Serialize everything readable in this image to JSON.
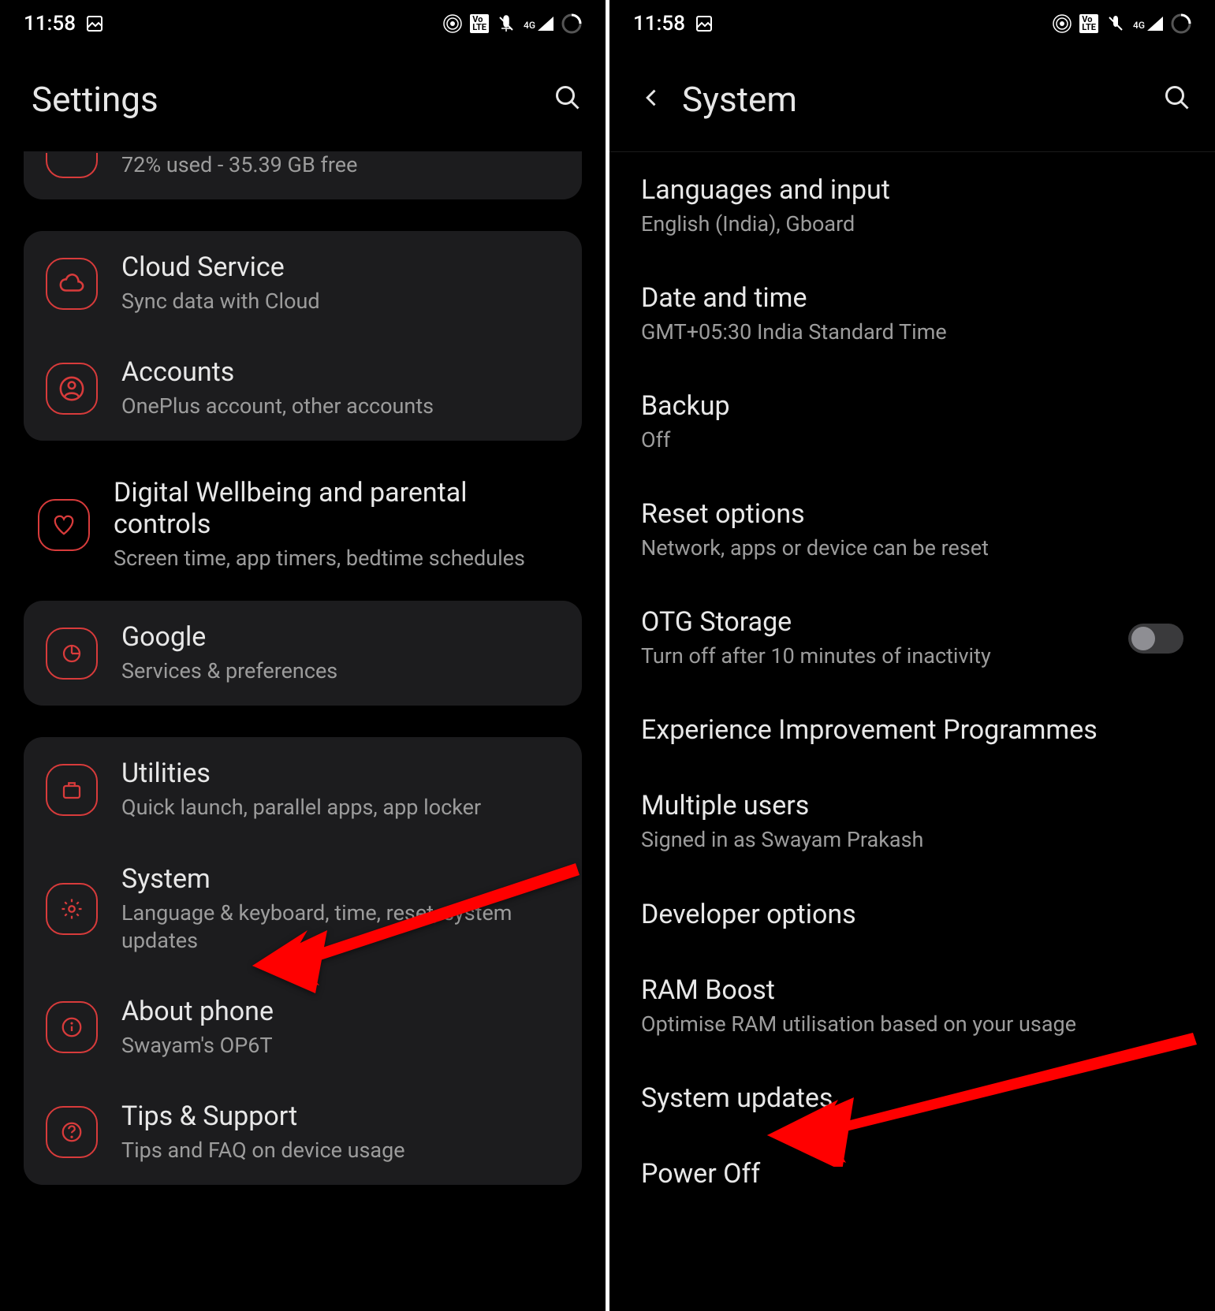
{
  "status": {
    "time": "11:58",
    "lte_badge": "Vo LTE",
    "signal_badge": "4G"
  },
  "left": {
    "header_title": "Settings",
    "storage_sub": "72% used - 35.39 GB free",
    "groups": [
      {
        "items": [
          {
            "title": "Cloud Service",
            "sub": "Sync data with Cloud"
          },
          {
            "title": "Accounts",
            "sub": "OnePlus account, other accounts"
          }
        ]
      }
    ],
    "wellbeing": {
      "title": "Digital Wellbeing and parental controls",
      "sub": "Screen time, app timers, bedtime schedules"
    },
    "google": {
      "title": "Google",
      "sub": "Services & preferences"
    },
    "utilities": {
      "title": "Utilities",
      "sub": "Quick launch, parallel apps, app locker"
    },
    "system": {
      "title": "System",
      "sub": "Language & keyboard, time, reset, system updates"
    },
    "about": {
      "title": "About phone",
      "sub": "Swayam's OP6T"
    },
    "tips": {
      "title": "Tips & Support",
      "sub": "Tips and FAQ on device usage"
    }
  },
  "right": {
    "header_title": "System",
    "languages": {
      "title": "Languages and input",
      "sub": "English (India), Gboard"
    },
    "datetime": {
      "title": "Date and time",
      "sub": "GMT+05:30 India Standard Time"
    },
    "backup": {
      "title": "Backup",
      "sub": "Off"
    },
    "reset": {
      "title": "Reset options",
      "sub": "Network, apps or device can be reset"
    },
    "otg": {
      "title": "OTG Storage",
      "sub": "Turn off after 10 minutes of inactivity"
    },
    "exp": {
      "title": "Experience Improvement Programmes"
    },
    "users": {
      "title": "Multiple users",
      "sub": "Signed in as Swayam Prakash"
    },
    "dev": {
      "title": "Developer options"
    },
    "ram": {
      "title": "RAM Boost",
      "sub": "Optimise RAM utilisation based on your usage"
    },
    "updates": {
      "title": "System updates"
    },
    "power": {
      "title": "Power Off"
    }
  }
}
